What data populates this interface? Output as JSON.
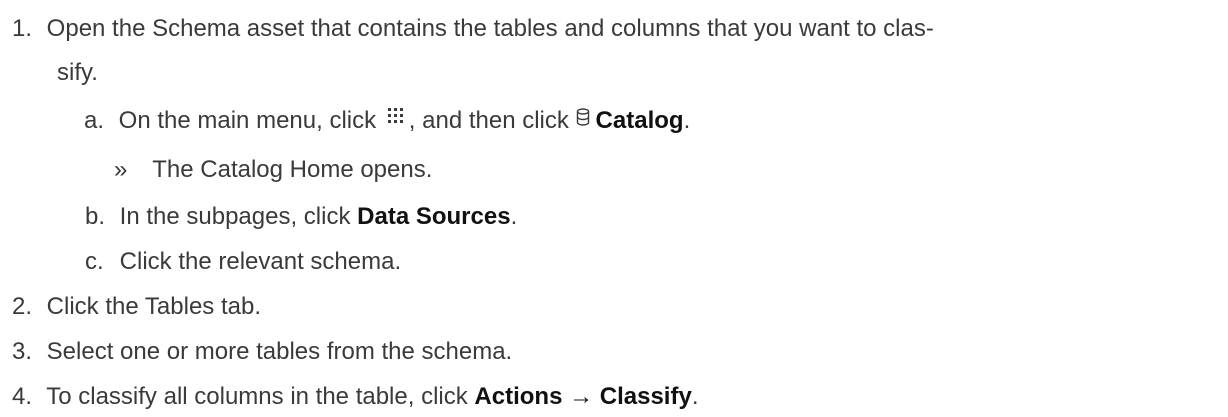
{
  "steps": {
    "s1": {
      "num": "1.",
      "text_a": "Open the Schema asset that contains the tables and columns that you want to clas-",
      "text_b": "sify.",
      "substeps": {
        "a": {
          "marker": "a.",
          "before_icon": "On the main menu, click",
          "after_icon": ", and then click",
          "catalog": "Catalog",
          "end": ".",
          "result_marker": "»",
          "result": "The Catalog Home opens."
        },
        "b": {
          "marker": "b.",
          "before": "In the subpages, click",
          "bold": "Data Sources",
          "end": "."
        },
        "c": {
          "marker": "c.",
          "text": "Click the relevant schema."
        }
      }
    },
    "s2": {
      "num": "2.",
      "text": "Click the Tables tab."
    },
    "s3": {
      "num": "3.",
      "text": "Select one or more tables from the schema."
    },
    "s4": {
      "num": "4.",
      "before": "To classify all columns in the table, click",
      "actions": "Actions",
      "arrow": "→",
      "classify": "Classify",
      "end": "."
    }
  }
}
